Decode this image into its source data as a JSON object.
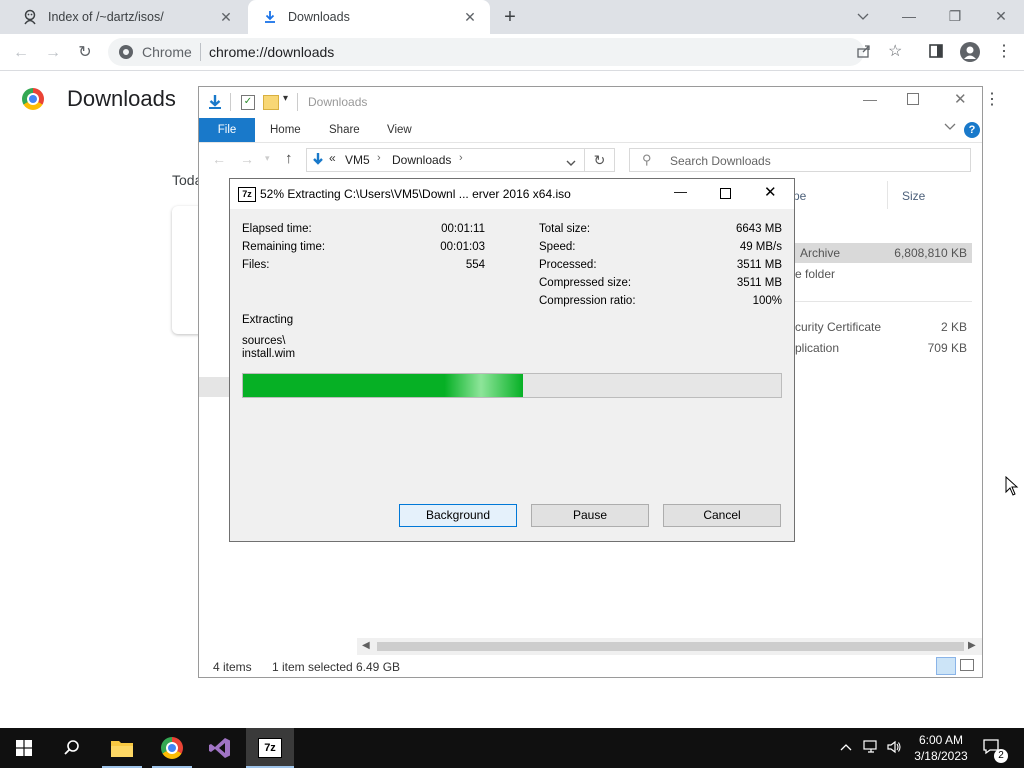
{
  "browser": {
    "tabs": [
      {
        "title": "Index of /~dartz/isos/",
        "active": false
      },
      {
        "title": "Downloads",
        "active": true
      }
    ],
    "omnibox": {
      "site_label": "Chrome",
      "url": "chrome://downloads"
    }
  },
  "downloads_page": {
    "title": "Downloads",
    "section_today": "Toda"
  },
  "explorer": {
    "title": "Downloads",
    "ribbon_tabs": [
      "File",
      "Home",
      "Share",
      "View"
    ],
    "breadcrumb": [
      "VM5",
      "Downloads"
    ],
    "breadcrumb_prefix": "«",
    "search_placeholder": "Search Downloads",
    "columns": {
      "type": "pe",
      "size": "Size"
    },
    "rows": [
      {
        "type": "Archive",
        "size": "6,808,810 KB"
      },
      {
        "type": "e folder",
        "size": ""
      },
      {
        "type": "curity Certificate",
        "size": "2 KB"
      },
      {
        "type": "plication",
        "size": "709 KB"
      }
    ],
    "status": {
      "items": "4 items",
      "selected": "1 item selected",
      "size": "6.49 GB"
    }
  },
  "sevenzip": {
    "icon_label": "7z",
    "title": "52% Extracting C:\\Users\\VM5\\Downl ... erver 2016 x64.iso",
    "left_stats": [
      {
        "label": "Elapsed time:",
        "value": "00:01:11"
      },
      {
        "label": "Remaining time:",
        "value": "00:01:03"
      },
      {
        "label": "Files:",
        "value": "554"
      }
    ],
    "right_stats": [
      {
        "label": "Total size:",
        "value": "6643 MB"
      },
      {
        "label": "Speed:",
        "value": "49 MB/s"
      },
      {
        "label": "Processed:",
        "value": "3511 MB"
      },
      {
        "label": "Compressed size:",
        "value": "3511 MB"
      },
      {
        "label": "Compression ratio:",
        "value": "100%"
      }
    ],
    "current_action": "Extracting",
    "current_path_line1": "sources\\",
    "current_path_line2": "install.wim",
    "progress_fraction": 0.52,
    "buttons": {
      "background": "Background",
      "pause": "Pause",
      "cancel": "Cancel"
    }
  },
  "taskbar": {
    "time": "6:00 AM",
    "date": "3/18/2023",
    "notification_count": "2",
    "sevenzip_label": "7z"
  },
  "colors": {
    "accent": "#1979ca",
    "progress": "#06b025",
    "taskbar": "#101010"
  }
}
